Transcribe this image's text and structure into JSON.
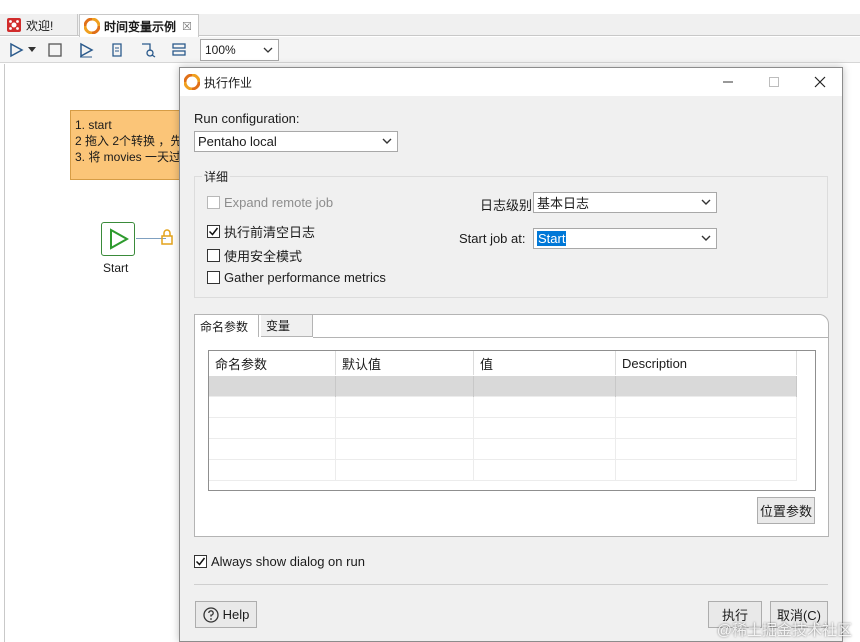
{
  "app": {
    "tabs": [
      {
        "label": "欢迎!",
        "icon": "welcome-icon"
      },
      {
        "label": "时间变量示例",
        "icon": "job-icon",
        "close": "☒"
      }
    ],
    "zoom": "100%"
  },
  "canvas": {
    "note_lines": [
      "1. start",
      "2 拖入 2个转换 ，先",
      "3. 将 movies 一天过"
    ],
    "start_label": "Start"
  },
  "dialog": {
    "title": "执行作业",
    "run_config_label": "Run configuration:",
    "run_config_value": "Pentaho local",
    "details_group": "详细",
    "expand_remote_job": "Expand remote job",
    "clear_log": "执行前清空日志",
    "safe_mode": "使用安全模式",
    "gather_metrics": "Gather performance metrics",
    "log_level_label": "日志级别",
    "log_level_value": "基本日志",
    "start_job_label": "Start job at:",
    "start_job_value": "Start",
    "tab_named_params": "命名参数",
    "tab_variables": "变量",
    "columns": [
      "命名参数",
      "默认值",
      "值",
      "Description"
    ],
    "position_params_button": "位置参数",
    "always_show": "Always show dialog on run",
    "help_button": "Help",
    "run_button": "执行",
    "cancel_button": "取消(C)"
  },
  "checkbox_state": {
    "expand_remote_job": false,
    "clear_log": true,
    "safe_mode": false,
    "gather_metrics": false,
    "always_show": true
  },
  "watermark": "@稀土掘金技术社区",
  "colors": {
    "note_bg": "#fbc578",
    "selection": "#0078d7",
    "start_green": "#2e9b2e"
  }
}
